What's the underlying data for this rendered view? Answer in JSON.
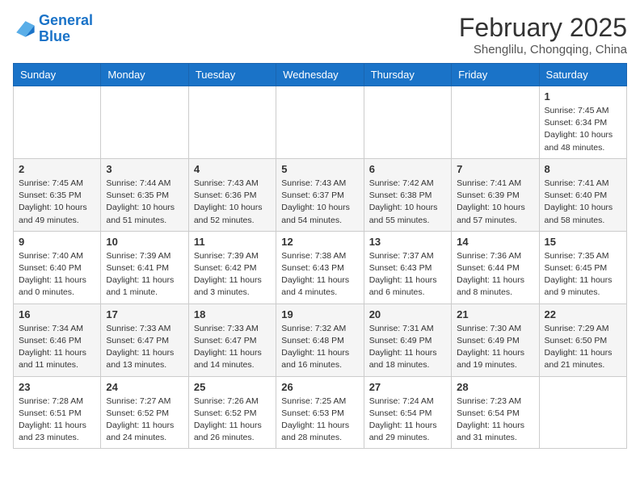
{
  "logo": {
    "line1": "General",
    "line2": "Blue"
  },
  "title": "February 2025",
  "location": "Shenglilu, Chongqing, China",
  "weekdays": [
    "Sunday",
    "Monday",
    "Tuesday",
    "Wednesday",
    "Thursday",
    "Friday",
    "Saturday"
  ],
  "weeks": [
    [
      {
        "day": "",
        "info": ""
      },
      {
        "day": "",
        "info": ""
      },
      {
        "day": "",
        "info": ""
      },
      {
        "day": "",
        "info": ""
      },
      {
        "day": "",
        "info": ""
      },
      {
        "day": "",
        "info": ""
      },
      {
        "day": "1",
        "info": "Sunrise: 7:45 AM\nSunset: 6:34 PM\nDaylight: 10 hours\nand 48 minutes."
      }
    ],
    [
      {
        "day": "2",
        "info": "Sunrise: 7:45 AM\nSunset: 6:35 PM\nDaylight: 10 hours\nand 49 minutes."
      },
      {
        "day": "3",
        "info": "Sunrise: 7:44 AM\nSunset: 6:35 PM\nDaylight: 10 hours\nand 51 minutes."
      },
      {
        "day": "4",
        "info": "Sunrise: 7:43 AM\nSunset: 6:36 PM\nDaylight: 10 hours\nand 52 minutes."
      },
      {
        "day": "5",
        "info": "Sunrise: 7:43 AM\nSunset: 6:37 PM\nDaylight: 10 hours\nand 54 minutes."
      },
      {
        "day": "6",
        "info": "Sunrise: 7:42 AM\nSunset: 6:38 PM\nDaylight: 10 hours\nand 55 minutes."
      },
      {
        "day": "7",
        "info": "Sunrise: 7:41 AM\nSunset: 6:39 PM\nDaylight: 10 hours\nand 57 minutes."
      },
      {
        "day": "8",
        "info": "Sunrise: 7:41 AM\nSunset: 6:40 PM\nDaylight: 10 hours\nand 58 minutes."
      }
    ],
    [
      {
        "day": "9",
        "info": "Sunrise: 7:40 AM\nSunset: 6:40 PM\nDaylight: 11 hours\nand 0 minutes."
      },
      {
        "day": "10",
        "info": "Sunrise: 7:39 AM\nSunset: 6:41 PM\nDaylight: 11 hours\nand 1 minute."
      },
      {
        "day": "11",
        "info": "Sunrise: 7:39 AM\nSunset: 6:42 PM\nDaylight: 11 hours\nand 3 minutes."
      },
      {
        "day": "12",
        "info": "Sunrise: 7:38 AM\nSunset: 6:43 PM\nDaylight: 11 hours\nand 4 minutes."
      },
      {
        "day": "13",
        "info": "Sunrise: 7:37 AM\nSunset: 6:43 PM\nDaylight: 11 hours\nand 6 minutes."
      },
      {
        "day": "14",
        "info": "Sunrise: 7:36 AM\nSunset: 6:44 PM\nDaylight: 11 hours\nand 8 minutes."
      },
      {
        "day": "15",
        "info": "Sunrise: 7:35 AM\nSunset: 6:45 PM\nDaylight: 11 hours\nand 9 minutes."
      }
    ],
    [
      {
        "day": "16",
        "info": "Sunrise: 7:34 AM\nSunset: 6:46 PM\nDaylight: 11 hours\nand 11 minutes."
      },
      {
        "day": "17",
        "info": "Sunrise: 7:33 AM\nSunset: 6:47 PM\nDaylight: 11 hours\nand 13 minutes."
      },
      {
        "day": "18",
        "info": "Sunrise: 7:33 AM\nSunset: 6:47 PM\nDaylight: 11 hours\nand 14 minutes."
      },
      {
        "day": "19",
        "info": "Sunrise: 7:32 AM\nSunset: 6:48 PM\nDaylight: 11 hours\nand 16 minutes."
      },
      {
        "day": "20",
        "info": "Sunrise: 7:31 AM\nSunset: 6:49 PM\nDaylight: 11 hours\nand 18 minutes."
      },
      {
        "day": "21",
        "info": "Sunrise: 7:30 AM\nSunset: 6:49 PM\nDaylight: 11 hours\nand 19 minutes."
      },
      {
        "day": "22",
        "info": "Sunrise: 7:29 AM\nSunset: 6:50 PM\nDaylight: 11 hours\nand 21 minutes."
      }
    ],
    [
      {
        "day": "23",
        "info": "Sunrise: 7:28 AM\nSunset: 6:51 PM\nDaylight: 11 hours\nand 23 minutes."
      },
      {
        "day": "24",
        "info": "Sunrise: 7:27 AM\nSunset: 6:52 PM\nDaylight: 11 hours\nand 24 minutes."
      },
      {
        "day": "25",
        "info": "Sunrise: 7:26 AM\nSunset: 6:52 PM\nDaylight: 11 hours\nand 26 minutes."
      },
      {
        "day": "26",
        "info": "Sunrise: 7:25 AM\nSunset: 6:53 PM\nDaylight: 11 hours\nand 28 minutes."
      },
      {
        "day": "27",
        "info": "Sunrise: 7:24 AM\nSunset: 6:54 PM\nDaylight: 11 hours\nand 29 minutes."
      },
      {
        "day": "28",
        "info": "Sunrise: 7:23 AM\nSunset: 6:54 PM\nDaylight: 11 hours\nand 31 minutes."
      },
      {
        "day": "",
        "info": ""
      }
    ]
  ]
}
